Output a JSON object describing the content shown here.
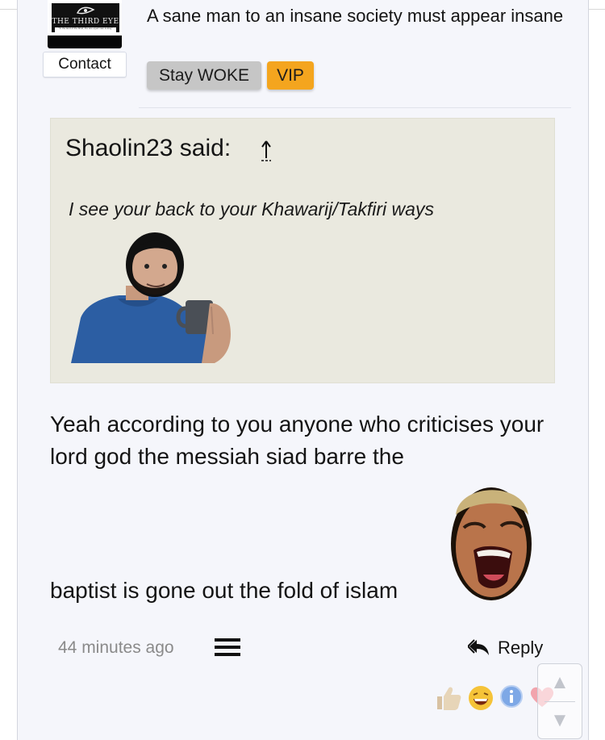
{
  "author": {
    "logo_text": "THE THIRD EYE",
    "logo_tagline": "\"In the land of the blind, the one-eyed man is king\"",
    "contact_label": "Contact",
    "signature": "A sane man to an insane society must appear insane",
    "badges": [
      {
        "label": "Stay WOKE",
        "color": "#c6c6c6"
      },
      {
        "label": "VIP",
        "color": "#f4a51e"
      }
    ]
  },
  "quote": {
    "author_line": "Shaolin23 said:",
    "jump_icon": "up-arrow-icon",
    "text": "I see your back to your Khawarij/Takfiri ways",
    "image": "man-holding-mug-image"
  },
  "post": {
    "text_line_1": "Yeah according to you anyone who criticises your lord god the messiah siad barre the",
    "image": "laughing-face-emoji-image",
    "text_line_2": "baptist is gone out the fold of islam"
  },
  "footer": {
    "timestamp": "44 minutes ago",
    "menu_icon": "hamburger-menu-icon",
    "reply_label": "Reply",
    "reply_icon": "reply-arrow-icon",
    "reactions": [
      "thumbs-up-icon",
      "laughing-emoji-icon",
      "info-icon",
      "heart-icon"
    ]
  },
  "scroll_controls": {
    "up_glyph": "▲",
    "down_glyph": "▼"
  },
  "colors": {
    "post_background": "#f5f6fb",
    "quote_background": "#eae9df",
    "vip_badge": "#f4a51e",
    "woke_badge": "#c6c6c6",
    "timestamp": "#8a8a8a"
  }
}
